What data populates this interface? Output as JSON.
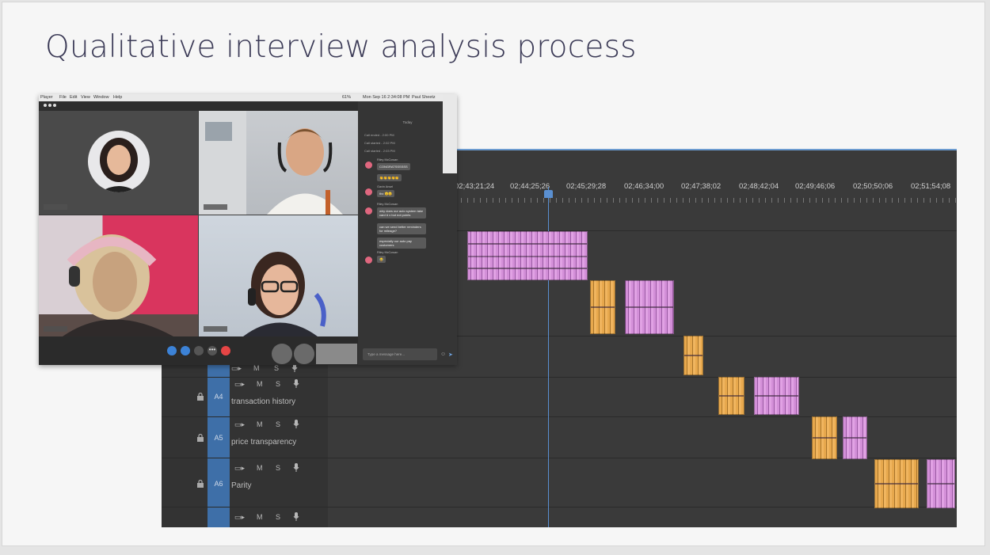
{
  "slide": {
    "title": "Qualitative interview analysis process"
  },
  "call": {
    "menu": [
      "Player",
      "File",
      "Edit",
      "View",
      "Window",
      "Help"
    ],
    "status": {
      "battery": "61%",
      "datetime": "Mon Sep 16 2:34:08 PM",
      "user": "Paul Sheetz"
    },
    "chat": {
      "day_label": "Today",
      "lines": [
        "Call ended - 2:00 PM",
        "Call started - 2:02 PM",
        "Call started - 2:03 PM"
      ],
      "messages": [
        {
          "sender": "Riley McCowan",
          "text": "CONGRATSSSSSS"
        },
        {
          "sender": "",
          "text": "👏👏👏👏👏"
        },
        {
          "sender": "Gavin Ansel",
          "text": "thx 😊😊"
        },
        {
          "sender": "Riley McCowan",
          "text": "why does our auto system take card # x but not points"
        },
        {
          "sender": "",
          "text": "can we send better reminders for mileage?"
        },
        {
          "sender": "",
          "text": "especially our auto pay customers"
        },
        {
          "sender": "Riley McCowan",
          "text": "😂"
        }
      ],
      "input_placeholder": "Type a message here..."
    }
  },
  "timeline": {
    "timecodes": [
      "02;43;21;24",
      "02;44;25;26",
      "02;45;29;28",
      "02;46;34;00",
      "02;47;38;02",
      "02;48;42;04",
      "02;49;46;06",
      "02;50;50;06",
      "02;51;54;08"
    ],
    "controls": {
      "mute": "M",
      "solo": "S"
    },
    "tracks": [
      {
        "id": "A4",
        "name": "transaction history"
      },
      {
        "id": "A5",
        "name": "price transparency"
      },
      {
        "id": "A6",
        "name": "Parity"
      }
    ],
    "clip_colors": {
      "pink": "#d38fd8",
      "orange": "#e7a84d"
    }
  },
  "icons": [
    "lock-icon",
    "camera-icon",
    "microphone-icon",
    "end-call-icon",
    "more-icon",
    "share-icon",
    "emoji-icon",
    "send-icon"
  ]
}
